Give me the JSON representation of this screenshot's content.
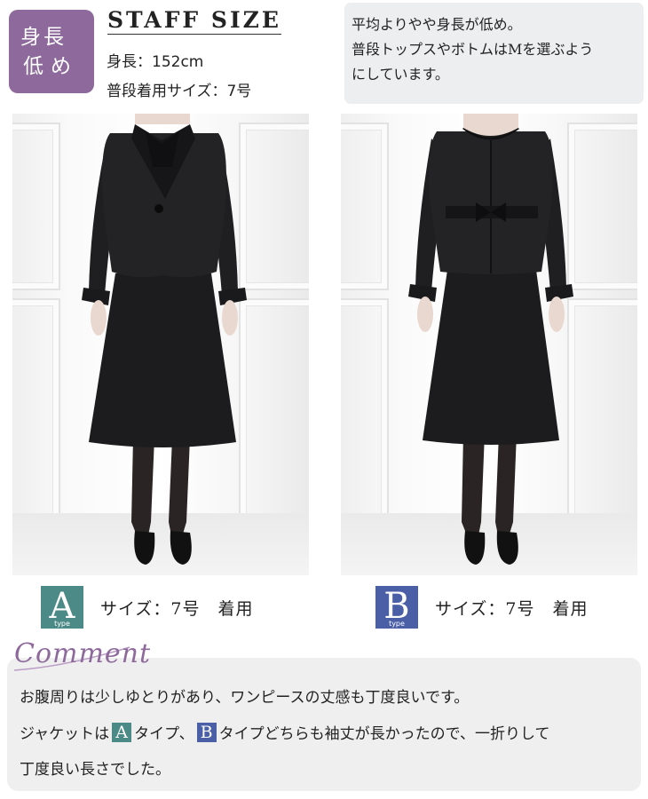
{
  "badge": {
    "line1": "身長",
    "line2": "低め"
  },
  "staff": {
    "title": "STAFF SIZE",
    "height": "身長：152cm",
    "usual_size": "普段着用サイズ：7号"
  },
  "note": {
    "lines": [
      "平均よりやや身長が低め。",
      "普段トップスやボトムはMを選ぶよう",
      "にしています。"
    ]
  },
  "models": [
    {
      "type_letter": "A",
      "type_word": "type",
      "caption": "サイズ：7号　着用",
      "color": "#4b8a86"
    },
    {
      "type_letter": "B",
      "type_word": "type",
      "caption": "サイズ：7号　着用",
      "color": "#4a5fa6"
    }
  ],
  "comment": {
    "title": "Comment",
    "line1": "お腹周りは少しゆとりがあり、ワンピースの丈感も丁度良いです。",
    "line2_pre": "ジャケットは",
    "line2_a": "A",
    "line2_mid": "タイプ、",
    "line2_b": "B",
    "line2_post": "タイプどちらも袖丈が長かったので、一折りして",
    "line3": "丁度良い長さでした。"
  }
}
